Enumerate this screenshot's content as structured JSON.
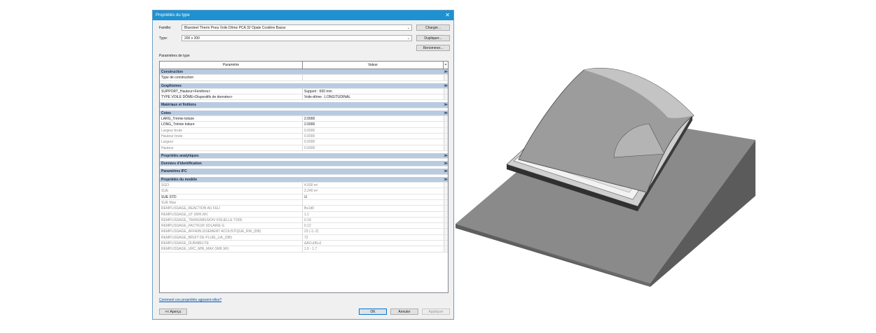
{
  "dialog": {
    "title": "Propriétés du type",
    "famille_label": "Famille:",
    "famille_value": "Bluesteel Therm Pneu Voile Dôme PCA 32 Opale Costière Basse",
    "type_label": "Type:",
    "type_value": "200 x 200",
    "charger": "Charger...",
    "dupliquer": "Dupliquer...",
    "renommer": "Renommer...",
    "params_title": "Paramètres de type",
    "col_param": "Paramètre",
    "col_value": "Valeur",
    "col_eq": "=",
    "rows": [
      {
        "kind": "group",
        "p": "Construction",
        "chev": "≫"
      },
      {
        "kind": "row",
        "p": "Type de construction",
        "v": ""
      },
      {
        "kind": "spacer"
      },
      {
        "kind": "group",
        "p": "Graphismes",
        "chev": "≫"
      },
      {
        "kind": "row",
        "p": "SUPPORT_Hauteur<Fenêtres>",
        "v": "Support : 600 mm"
      },
      {
        "kind": "row",
        "p": "TYPE VOILE DÔME<Dispositifs de données>",
        "v": "Voile-dôme : LONGITUDINAL"
      },
      {
        "kind": "spacer"
      },
      {
        "kind": "group",
        "p": "Matériaux et finitions",
        "chev": "≫"
      },
      {
        "kind": "spacer"
      },
      {
        "kind": "group",
        "p": "Cotes",
        "chev": "≫"
      },
      {
        "kind": "row",
        "p": "LARG_Trémie toiture",
        "v": "2.0000"
      },
      {
        "kind": "row",
        "p": "LONG_Trémie toiture",
        "v": "2.0000"
      },
      {
        "kind": "gray",
        "p": "Largeur brute",
        "v": "0.0000"
      },
      {
        "kind": "gray",
        "p": "Hauteur brute",
        "v": "0.0000"
      },
      {
        "kind": "gray",
        "p": "Largeur",
        "v": "0.0000"
      },
      {
        "kind": "gray",
        "p": "Hauteur",
        "v": "0.0000"
      },
      {
        "kind": "spacer"
      },
      {
        "kind": "group",
        "p": "Propriétés analytiques",
        "chev": "≫"
      },
      {
        "kind": "spacer"
      },
      {
        "kind": "group",
        "p": "Données d'identification",
        "chev": "≫"
      },
      {
        "kind": "spacer"
      },
      {
        "kind": "group",
        "p": "Paramètres IFC",
        "chev": "≫"
      },
      {
        "kind": "spacer"
      },
      {
        "kind": "group",
        "p": "Propriétés du modèle",
        "chev": "≫"
      },
      {
        "kind": "gray",
        "p": "SGO",
        "v": "4.000 m²"
      },
      {
        "kind": "gray",
        "p": "SUE",
        "v": "2.240 m²"
      },
      {
        "kind": "check",
        "p": "SUE STD",
        "v": "☑"
      },
      {
        "kind": "gray",
        "p": "SUE Max",
        "v": ""
      },
      {
        "kind": "gray",
        "p": "REMPLISSAGE_REACTION AU FEU",
        "v": "Bs1d0"
      },
      {
        "kind": "gray",
        "p": "REMPLISSAGE_UT (W/K.M²)",
        "v": "1.1"
      },
      {
        "kind": "gray",
        "p": "REMPLISSAGE_TRANSMISSION VISUELLE TD65",
        "v": "0.18"
      },
      {
        "kind": "gray",
        "p": "REMPLISSAGE_FACTEUR SOLAIRE G",
        "v": "0.12"
      },
      {
        "kind": "gray",
        "p": "REMPLISSAGE_AFFAIBLISSEMENT ACOUSTIQUE_RW_(DB)",
        "v": "23 (-1;-2)"
      },
      {
        "kind": "gray",
        "p": "REMPLISSAGE_BRUIT DE PLUIE_LIA_(DB)",
        "v": "72"
      },
      {
        "kind": "gray",
        "p": "REMPLISSAGE_DURABILITE",
        "v": "ΔACu0Ku1"
      },
      {
        "kind": "gray",
        "p": "REMPLISSAGE_URC_MIN_MAX (W/K.M²)",
        "v": "1.5 - 1.7"
      }
    ],
    "help_link": "Comment ces propriétés agissent-elles?",
    "apercu": "<< Aperçu",
    "ok": "OK",
    "annuler": "Annuler",
    "appliquer": "Appliquer"
  }
}
